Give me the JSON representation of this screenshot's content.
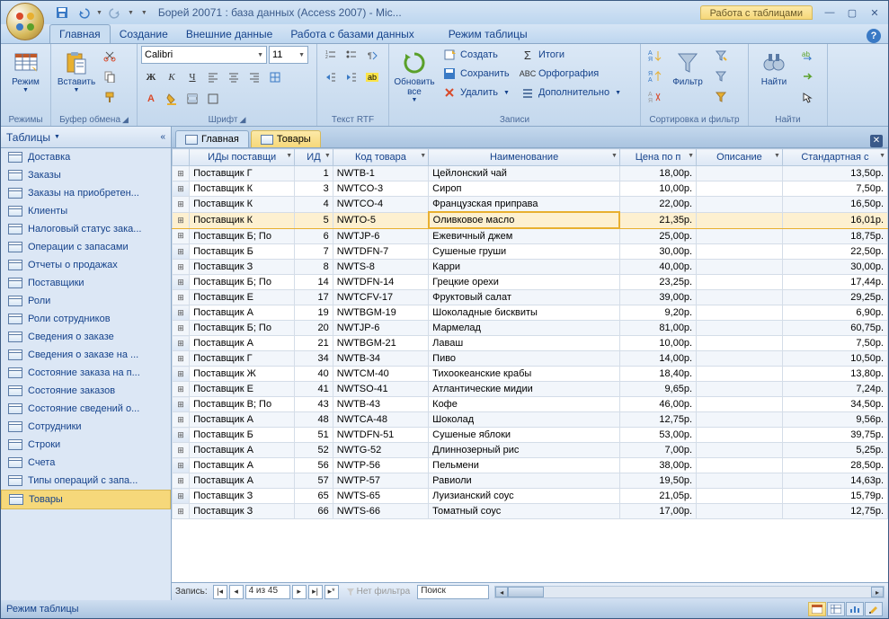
{
  "title": "Борей 20071 : база данных (Access 2007) - Mic...",
  "context_tab_group": "Работа с таблицами",
  "ribbon_tabs": [
    "Главная",
    "Создание",
    "Внешние данные",
    "Работа с базами данных",
    "Режим таблицы"
  ],
  "ribbon": {
    "modes": {
      "view": "Режим",
      "label": "Режимы"
    },
    "clipboard": {
      "paste": "Вставить",
      "label": "Буфер обмена"
    },
    "font": {
      "name": "Calibri",
      "size": "11",
      "label": "Шрифт"
    },
    "rtf": {
      "label": "Текст RTF"
    },
    "refresh": {
      "btn": "Обновить\nвсе",
      "label": "Записи",
      "create": "Создать",
      "save": "Сохранить",
      "delete": "Удалить",
      "totals": "Итоги",
      "spell": "Орфография",
      "more": "Дополнительно"
    },
    "sort": {
      "filter": "Фильтр",
      "label": "Сортировка и фильтр"
    },
    "find": {
      "btn": "Найти",
      "label": "Найти"
    }
  },
  "navpane": {
    "header": "Таблицы",
    "items": [
      "Доставка",
      "Заказы",
      "Заказы на приобретен...",
      "Клиенты",
      "Налоговый статус зака...",
      "Операции с запасами",
      "Отчеты о продажах",
      "Поставщики",
      "Роли",
      "Роли сотрудников",
      "Сведения о заказе",
      "Сведения о заказе на ...",
      "Состояние заказа на п...",
      "Состояние заказов",
      "Состояние сведений о...",
      "Сотрудники",
      "Строки",
      "Счета",
      "Типы операций с запа...",
      "Товары"
    ]
  },
  "doctabs": [
    {
      "label": "Главная",
      "active": false
    },
    {
      "label": "Товары",
      "active": true
    }
  ],
  "columns": [
    "ИДы поставщи",
    "ИД",
    "Код товара",
    "Наименование",
    "Цена по п",
    "Описание",
    "Стандартная с"
  ],
  "rows": [
    {
      "s": "Поставщик Г",
      "id": 1,
      "code": "NWTB-1",
      "name": "Цейлонский чай",
      "price": "18,00р.",
      "desc": "",
      "std": "13,50р."
    },
    {
      "s": "Поставщик К",
      "id": 3,
      "code": "NWTCO-3",
      "name": "Сироп",
      "price": "10,00р.",
      "desc": "",
      "std": "7,50р."
    },
    {
      "s": "Поставщик К",
      "id": 4,
      "code": "NWTCO-4",
      "name": "Французская приправа",
      "price": "22,00р.",
      "desc": "",
      "std": "16,50р."
    },
    {
      "s": "Поставщик К",
      "id": 5,
      "code": "NWTO-5",
      "name": "Оливковое масло",
      "price": "21,35р.",
      "desc": "",
      "std": "16,01р.",
      "sel": true
    },
    {
      "s": "Поставщик Б; По",
      "id": 6,
      "code": "NWTJP-6",
      "name": "Ежевичный джем",
      "price": "25,00р.",
      "desc": "",
      "std": "18,75р."
    },
    {
      "s": "Поставщик Б",
      "id": 7,
      "code": "NWTDFN-7",
      "name": "Сушеные груши",
      "price": "30,00р.",
      "desc": "",
      "std": "22,50р."
    },
    {
      "s": "Поставщик З",
      "id": 8,
      "code": "NWTS-8",
      "name": "Карри",
      "price": "40,00р.",
      "desc": "",
      "std": "30,00р."
    },
    {
      "s": "Поставщик Б; По",
      "id": 14,
      "code": "NWTDFN-14",
      "name": "Грецкие орехи",
      "price": "23,25р.",
      "desc": "",
      "std": "17,44р."
    },
    {
      "s": "Поставщик Е",
      "id": 17,
      "code": "NWTCFV-17",
      "name": "Фруктовый салат",
      "price": "39,00р.",
      "desc": "",
      "std": "29,25р."
    },
    {
      "s": "Поставщик А",
      "id": 19,
      "code": "NWTBGM-19",
      "name": "Шоколадные бисквиты",
      "price": "9,20р.",
      "desc": "",
      "std": "6,90р."
    },
    {
      "s": "Поставщик Б; По",
      "id": 20,
      "code": "NWTJP-6",
      "name": "Мармелад",
      "price": "81,00р.",
      "desc": "",
      "std": "60,75р."
    },
    {
      "s": "Поставщик А",
      "id": 21,
      "code": "NWTBGM-21",
      "name": "Лаваш",
      "price": "10,00р.",
      "desc": "",
      "std": "7,50р."
    },
    {
      "s": "Поставщик Г",
      "id": 34,
      "code": "NWTB-34",
      "name": "Пиво",
      "price": "14,00р.",
      "desc": "",
      "std": "10,50р."
    },
    {
      "s": "Поставщик Ж",
      "id": 40,
      "code": "NWTCM-40",
      "name": "Тихоокеанские крабы",
      "price": "18,40р.",
      "desc": "",
      "std": "13,80р."
    },
    {
      "s": "Поставщик Е",
      "id": 41,
      "code": "NWTSO-41",
      "name": "Атлантические мидии",
      "price": "9,65р.",
      "desc": "",
      "std": "7,24р."
    },
    {
      "s": "Поставщик В; По",
      "id": 43,
      "code": "NWTB-43",
      "name": "Кофе",
      "price": "46,00р.",
      "desc": "",
      "std": "34,50р."
    },
    {
      "s": "Поставщик А",
      "id": 48,
      "code": "NWTCA-48",
      "name": "Шоколад",
      "price": "12,75р.",
      "desc": "",
      "std": "9,56р."
    },
    {
      "s": "Поставщик Б",
      "id": 51,
      "code": "NWTDFN-51",
      "name": "Сушеные яблоки",
      "price": "53,00р.",
      "desc": "",
      "std": "39,75р."
    },
    {
      "s": "Поставщик А",
      "id": 52,
      "code": "NWTG-52",
      "name": "Длиннозерный рис",
      "price": "7,00р.",
      "desc": "",
      "std": "5,25р."
    },
    {
      "s": "Поставщик А",
      "id": 56,
      "code": "NWTP-56",
      "name": "Пельмени",
      "price": "38,00р.",
      "desc": "",
      "std": "28,50р."
    },
    {
      "s": "Поставщик А",
      "id": 57,
      "code": "NWTP-57",
      "name": "Равиоли",
      "price": "19,50р.",
      "desc": "",
      "std": "14,63р."
    },
    {
      "s": "Поставщик З",
      "id": 65,
      "code": "NWTS-65",
      "name": "Луизианский соус",
      "price": "21,05р.",
      "desc": "",
      "std": "15,79р."
    },
    {
      "s": "Поставщик З",
      "id": 66,
      "code": "NWTS-66",
      "name": "Томатный соус",
      "price": "17,00р.",
      "desc": "",
      "std": "12,75р."
    }
  ],
  "recnav": {
    "label": "Запись:",
    "pos": "4 из 45",
    "filter": "Нет фильтра",
    "search": "Поиск"
  },
  "status": "Режим таблицы"
}
